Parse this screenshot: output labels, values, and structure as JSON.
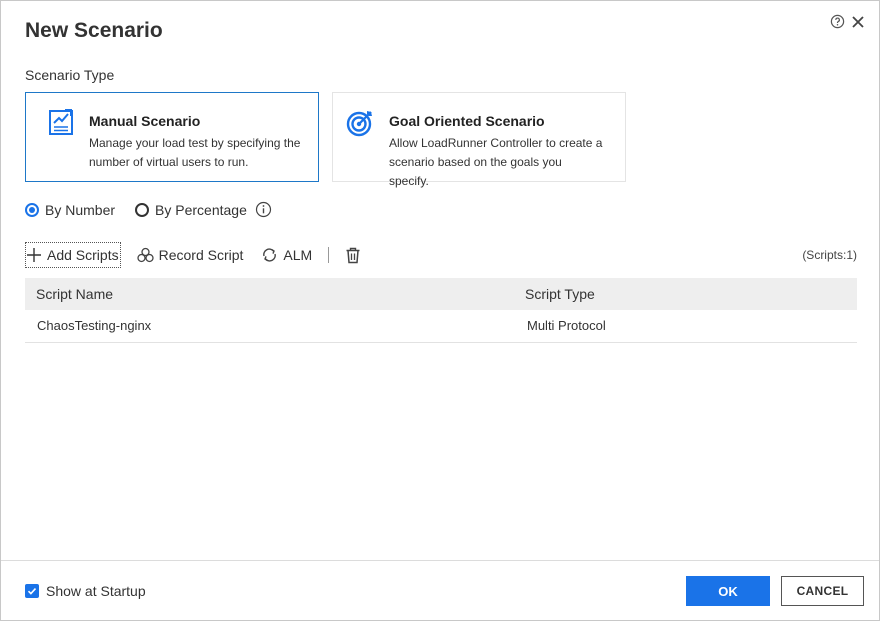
{
  "dialog": {
    "title": "New Scenario"
  },
  "header_icons": [
    "help-icon",
    "close-icon"
  ],
  "scenario_type": {
    "label": "Scenario Type",
    "cards": [
      {
        "title": "Manual Scenario",
        "description": "Manage your load test by specifying the number of virtual users to run.",
        "icon": "manual-scenario-icon",
        "selected": true
      },
      {
        "title": "Goal Oriented Scenario",
        "description": "Allow LoadRunner Controller to create a scenario based on the goals you specify.",
        "icon": "target-icon",
        "selected": false
      }
    ]
  },
  "mode": {
    "options": [
      {
        "label": "By Number",
        "checked": true
      },
      {
        "label": "By Percentage",
        "checked": false
      }
    ]
  },
  "toolbar": {
    "add_scripts": "Add Scripts",
    "record_script": "Record Script",
    "alm": "ALM",
    "scripts_count": "(Scripts:1)"
  },
  "grid": {
    "columns": [
      "Script Name",
      "Script Type"
    ],
    "rows": [
      {
        "name": "ChaosTesting-nginx",
        "type": "Multi Protocol"
      }
    ]
  },
  "footer": {
    "show_at_startup": "Show at Startup",
    "show_at_startup_checked": true,
    "ok": "OK",
    "cancel": "CANCEL"
  },
  "colors": {
    "accent": "#1a73e8",
    "selected_border": "#1e78c8",
    "header_bg": "#eeeeee"
  }
}
